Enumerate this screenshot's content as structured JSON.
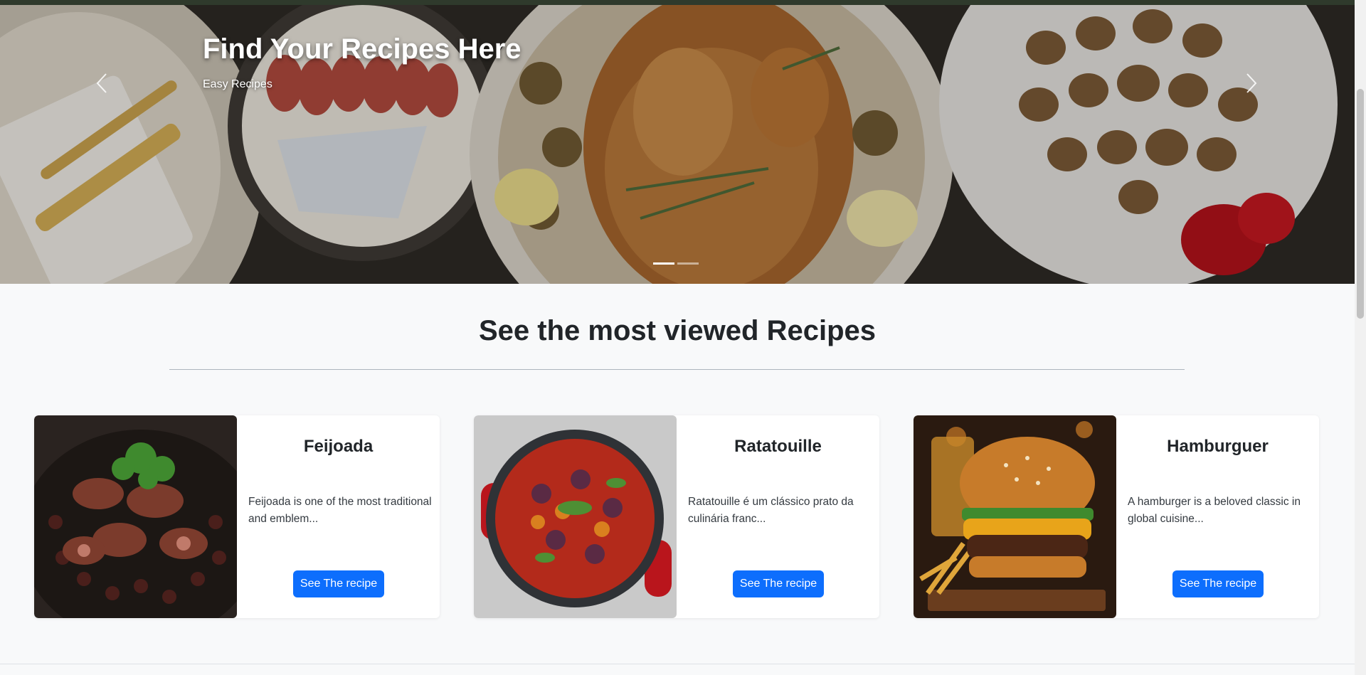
{
  "hero": {
    "title": "Find Your Recipes Here",
    "subtitle": "Easy Recipes",
    "prev_icon": "chevron-left-icon",
    "next_icon": "chevron-right-icon",
    "slides_count": 2,
    "active_slide": 1
  },
  "section": {
    "title": "See the most viewed Recipes"
  },
  "recipes": [
    {
      "name": "Feijoada",
      "description": "Feijoada is one of the most traditional and emblem...",
      "button": "See The recipe"
    },
    {
      "name": "Ratatouille",
      "description": "Ratatouille é um clássico prato da culinária franc...",
      "button": "See The recipe"
    },
    {
      "name": "Hamburguer",
      "description": "A hamburger is a beloved classic in global cuisine...",
      "button": "See The recipe"
    }
  ],
  "colors": {
    "primary": "#0d6efd",
    "page_background": "#f8f9fa",
    "topbar": "#2f3a2c"
  }
}
